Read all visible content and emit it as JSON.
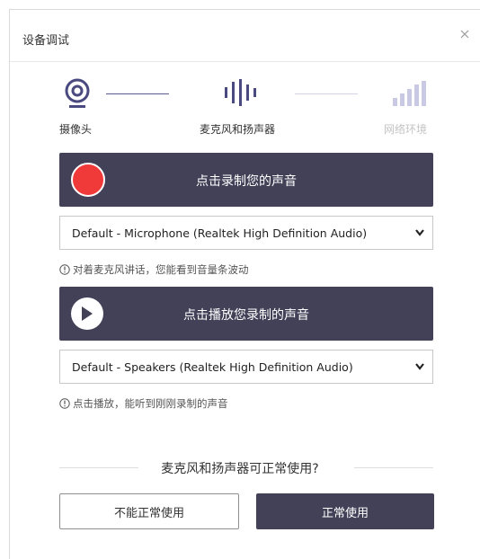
{
  "dialog": {
    "title": "设备调试"
  },
  "steps": [
    {
      "label": "摄像头",
      "icon": "camera-icon",
      "state": "done"
    },
    {
      "label": "麦克风和扬声器",
      "icon": "audio-wave-icon",
      "state": "active"
    },
    {
      "label": "网络环境",
      "icon": "signal-bars-icon",
      "state": "pending"
    }
  ],
  "record": {
    "button_label": "点击录制您的声音",
    "icon": "record-icon"
  },
  "microphone": {
    "selected": "Default - Microphone (Realtek High Definition Audio)",
    "hint": "对着麦克风讲话，您能看到音量条波动"
  },
  "playback": {
    "button_label": "点击播放您录制的声音",
    "icon": "play-icon"
  },
  "speaker": {
    "selected": "Default - Speakers (Realtek High Definition Audio)",
    "hint": "点击播放，能听到刚刚录制的声音"
  },
  "question": "麦克风和扬声器可正常使用?",
  "actions": {
    "cannot_use": "不能正常使用",
    "works": "正常使用"
  },
  "colors": {
    "accent": "#434158",
    "record_red": "#f03a3a",
    "step_active": "#4a4a80",
    "step_inactive": "#c9c9e3"
  }
}
